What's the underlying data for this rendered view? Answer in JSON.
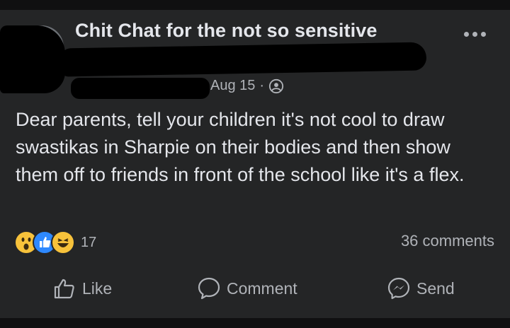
{
  "post": {
    "group_name": "Chit Chat for the not so sensitive",
    "date": "Aug 15",
    "separator": "·",
    "privacy_icon": "globe-icon",
    "body": "Dear parents, tell your children it's not cool to draw swastikas in Sharpie on their bodies and then show them off to friends in front of the school like it's a flex."
  },
  "stats": {
    "reaction_icons": [
      "wow-icon",
      "like-icon",
      "haha-icon"
    ],
    "reaction_count": "17",
    "comments": "36 comments"
  },
  "actions": {
    "like": "Like",
    "comment": "Comment",
    "send": "Send"
  },
  "colors": {
    "background": "#242526",
    "text_primary": "#e4e6eb",
    "text_secondary": "#b0b3b8",
    "like_blue": "#2e89ff",
    "emoji_yellow": "#f7c23b"
  }
}
